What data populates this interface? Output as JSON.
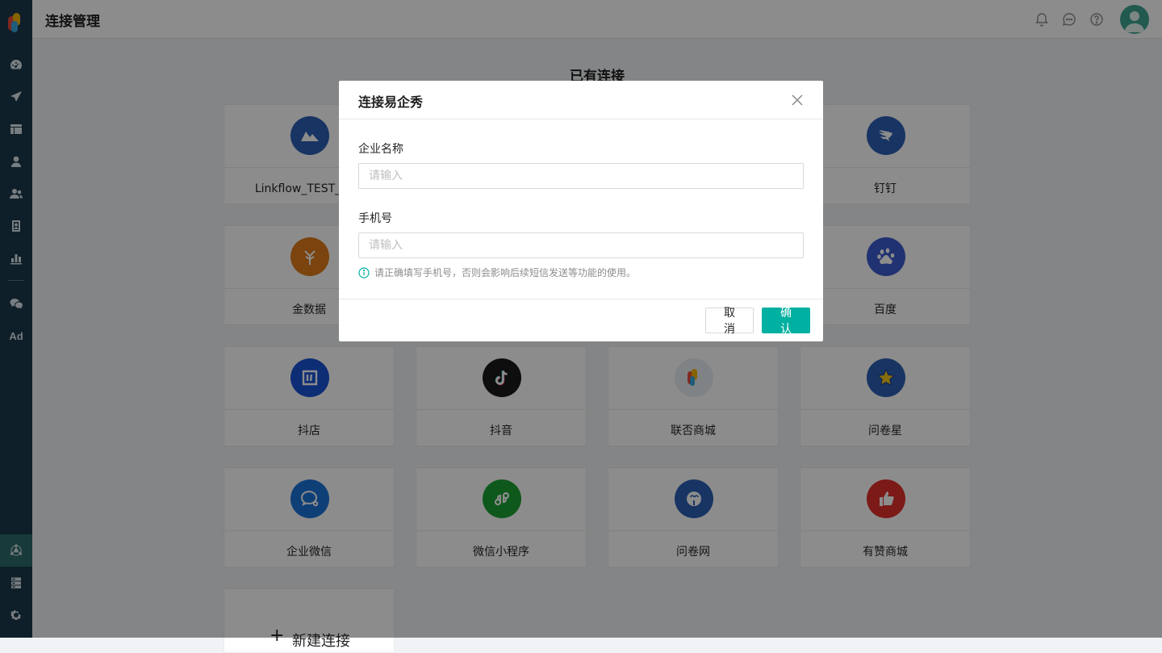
{
  "header": {
    "title": "连接管理",
    "icons": [
      "bell-icon",
      "message-icon",
      "help-icon",
      "user-avatar"
    ]
  },
  "sidebar": {
    "items": [
      {
        "icon": "dashboard-icon"
      },
      {
        "icon": "send-icon"
      },
      {
        "icon": "table-icon"
      },
      {
        "icon": "user-icon"
      },
      {
        "icon": "users-icon"
      },
      {
        "icon": "id-badge-icon"
      },
      {
        "icon": "bar-chart-icon"
      },
      {
        "icon": "wechat-icon"
      },
      {
        "icon": "ad-icon",
        "label": "Ad"
      },
      {
        "icon": "connection-icon",
        "active": true
      },
      {
        "icon": "server-icon"
      },
      {
        "icon": "settings-icon"
      }
    ]
  },
  "main": {
    "section_title": "已有连接",
    "connections": [
      {
        "name": "Linkflow_TEST_最大",
        "color": "#2b5fb5"
      },
      {
        "name": "钉钉",
        "color": "#2b5fb5"
      },
      {
        "name": "金数据",
        "color": "#e07b1a"
      },
      {
        "name": "百度",
        "color": "#3d5ccf"
      },
      {
        "name": "抖店",
        "color": "#1853d6"
      },
      {
        "name": "抖音",
        "color": "#1a1a1a"
      },
      {
        "name": "联否商城",
        "color": "#e9eef3"
      },
      {
        "name": "问卷星",
        "color": "#2b5fb5"
      },
      {
        "name": "企业微信",
        "color": "#1a73d9"
      },
      {
        "name": "微信小程序",
        "color": "#1aa033"
      },
      {
        "name": "问卷网",
        "color": "#2b5fb5"
      },
      {
        "name": "有赞商城",
        "color": "#e0302a"
      }
    ],
    "new_connection": {
      "label": "新建连接"
    }
  },
  "modal": {
    "title": "连接易企秀",
    "company_label": "企业名称",
    "company_placeholder": "请输入",
    "company_value": "",
    "phone_label": "手机号",
    "phone_placeholder": "请输入",
    "phone_value": "",
    "hint": "请正确填写手机号，否则会影响后续短信发送等功能的使用。",
    "cancel_label": "取消",
    "confirm_label": "确认"
  },
  "colors": {
    "sidebar_bg": "#1b3a4b",
    "accent": "#00b0a0",
    "sidebar_active": "#2d6a6a"
  }
}
